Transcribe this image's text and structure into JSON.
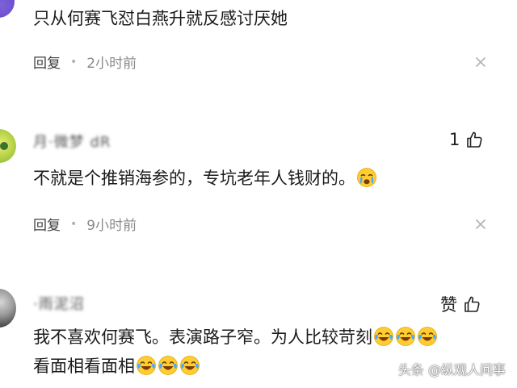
{
  "comments": [
    {
      "username": "",
      "text": "只从何赛飞怼白燕升就反感讨厌她",
      "reply_label": "回复",
      "time": "2小时前",
      "likes": ""
    },
    {
      "username": "月·微梦 dR",
      "text": "不就是个推销海参的，专坑老年人钱财的。",
      "reply_label": "回复",
      "time": "9小时前",
      "likes": "1",
      "emoji": "crying-face"
    },
    {
      "username": "·雨泥沼",
      "text_line1": "我不喜欢何赛飞。表演路子窄。为人比较苛刻",
      "text_line2": "看面相看面相",
      "like_label": "赞",
      "emoji": "laughing-crying-face"
    }
  ],
  "watermark": "头条 @纵观人间事",
  "colors": {
    "text": "#1b1b1b",
    "meta": "#8a8a8a",
    "emoji_face": "#ffcc33",
    "emoji_tear": "#4aa9ff"
  }
}
